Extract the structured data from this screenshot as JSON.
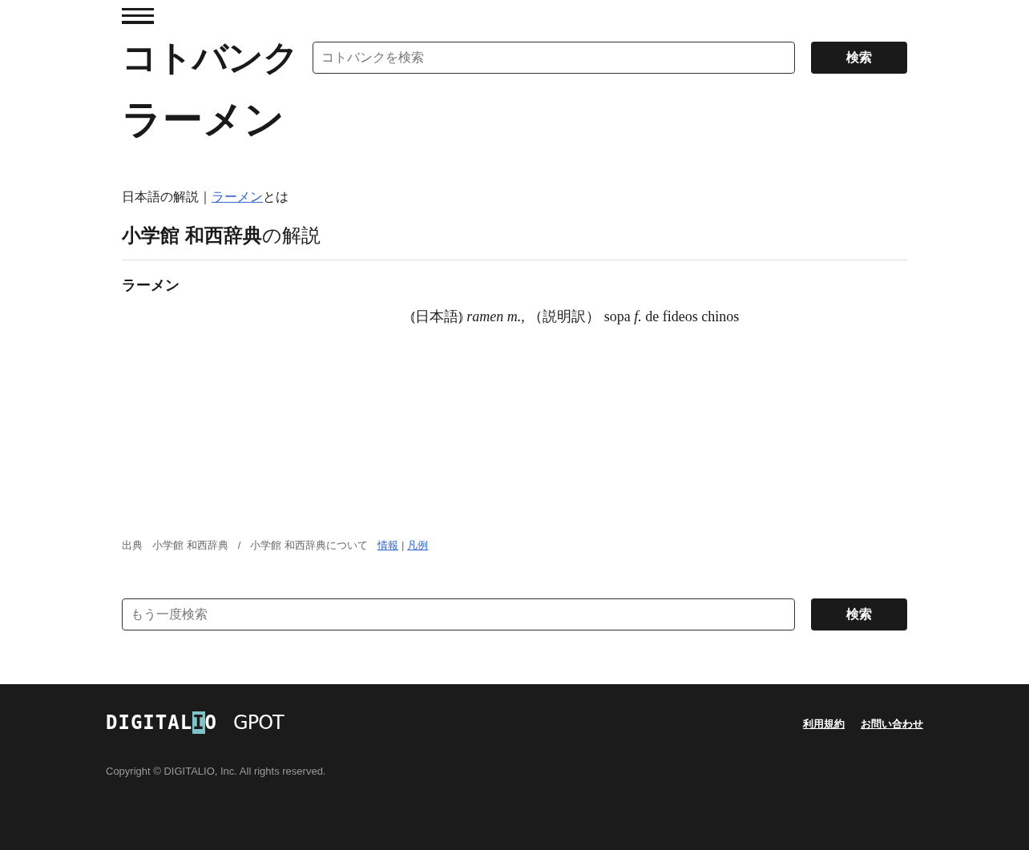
{
  "header": {
    "logo": "コトバンク",
    "search": {
      "placeholder": "コトバンクを検索"
    },
    "search_button": "検索"
  },
  "title": "ラーメン",
  "breadcrumb": {
    "prefix": "日本語の解説｜",
    "link": "ラーメン",
    "suffix": "とは"
  },
  "source_heading": {
    "bold": "小学館 和西辞典",
    "rest": "の解説"
  },
  "entry": {
    "headword": "ラーメン",
    "definition": "⦅日本語⦆ *ramen m.*, （説明訳） sopa *f.* de fideos chinos"
  },
  "citation": {
    "label": "出典",
    "source": "小学館 和西辞典",
    "separator": "/",
    "about": "小学館 和西辞典について",
    "links": [
      "情報",
      "凡例"
    ],
    "link_separator": "|"
  },
  "bottom_search": {
    "placeholder": "もう一度検索",
    "button": "検索"
  },
  "footer": {
    "logos": [
      "DIGITAL",
      "I",
      "O",
      "GPOT"
    ],
    "links": [
      "利用規約",
      "お問い合わせ"
    ],
    "copyright": "Copyright © DIGITALIO, Inc. All rights reserved."
  }
}
